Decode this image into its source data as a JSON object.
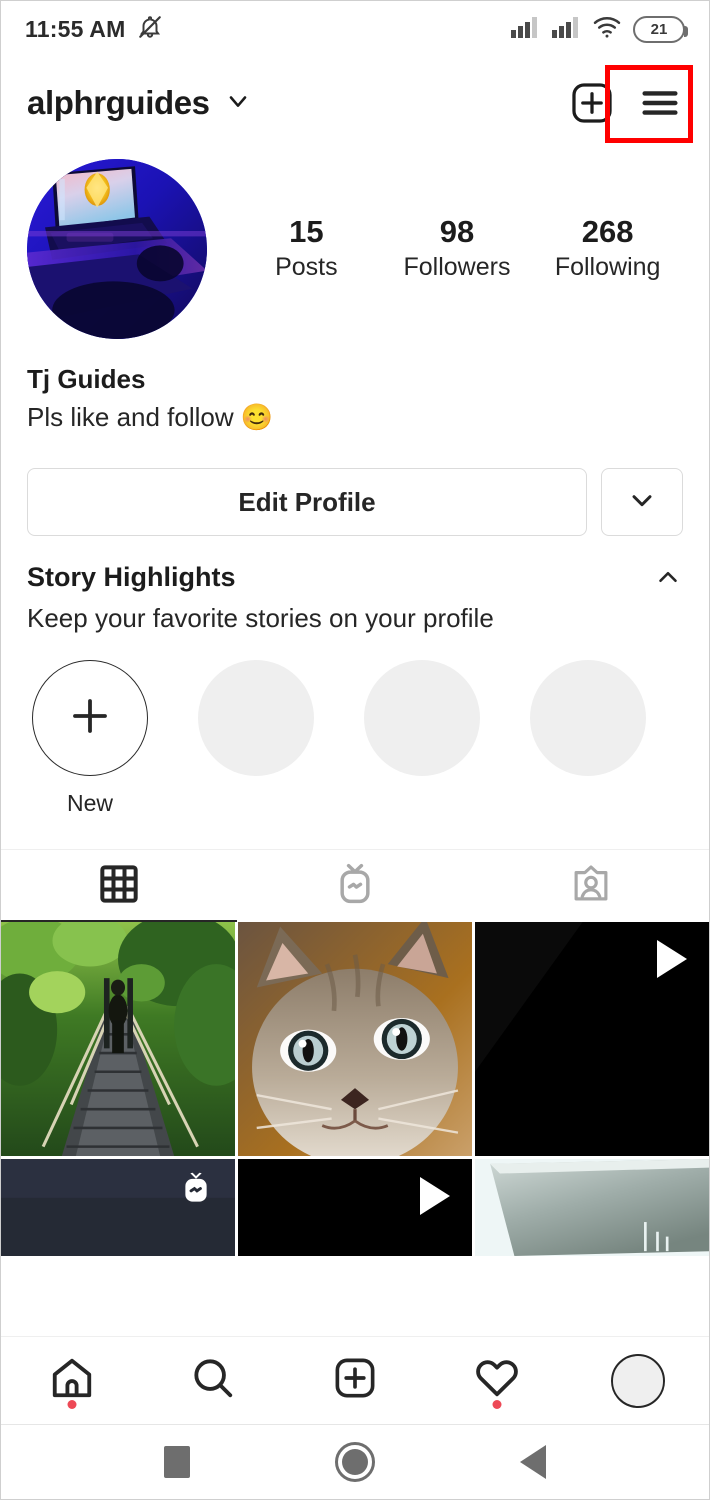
{
  "status_bar": {
    "time": "11:55 AM",
    "notification_icon": "bell-muted-icon",
    "signal_1_icon": "cellular-signal-icon",
    "signal_2_icon": "cellular-signal-icon",
    "wifi_icon": "wifi-icon",
    "battery_level": "21",
    "battery_icon": "battery-icon"
  },
  "header": {
    "username": "alphrguides",
    "dropdown_icon": "chevron-down-icon",
    "add_icon": "plus-square-icon",
    "menu_icon": "hamburger-menu-icon",
    "annotation_color": "#ff0000"
  },
  "profile": {
    "avatar_icon": "profile-avatar",
    "stats": [
      {
        "value": "15",
        "label": "Posts"
      },
      {
        "value": "98",
        "label": "Followers"
      },
      {
        "value": "268",
        "label": "Following"
      }
    ],
    "display_name": "Tj Guides",
    "bio": "Pls like and follow 😊"
  },
  "actions": {
    "edit_profile_label": "Edit Profile",
    "caret_icon": "chevron-down-icon"
  },
  "highlights": {
    "title": "Story Highlights",
    "subtitle": "Keep your favorite stories on your profile",
    "collapse_icon": "chevron-up-icon",
    "new_label": "New",
    "new_icon": "plus-icon",
    "placeholder_count": 3
  },
  "tabs": [
    {
      "name": "grid",
      "icon": "grid-icon",
      "active": true
    },
    {
      "name": "igtv",
      "icon": "igtv-icon",
      "active": false
    },
    {
      "name": "tagged",
      "icon": "tagged-person-icon",
      "active": false
    }
  ],
  "grid_posts": [
    {
      "id": "post-1",
      "type": "photo",
      "subject": "jungle-rope-bridge"
    },
    {
      "id": "post-2",
      "type": "photo",
      "subject": "tabby-kitten"
    },
    {
      "id": "post-3",
      "type": "video",
      "subject": "dark-video",
      "overlay_icon": "play-icon"
    },
    {
      "id": "post-4",
      "type": "igtv",
      "subject": "dark-igtv",
      "overlay_icon": "igtv-icon"
    },
    {
      "id": "post-5",
      "type": "video",
      "subject": "black-video",
      "overlay_icon": "play-icon"
    },
    {
      "id": "post-6",
      "type": "photo",
      "subject": "laptop-lid"
    }
  ],
  "bottom_nav": [
    {
      "name": "home",
      "icon": "home-icon",
      "badge": true
    },
    {
      "name": "search",
      "icon": "search-icon",
      "badge": false
    },
    {
      "name": "create",
      "icon": "plus-square-icon",
      "badge": false
    },
    {
      "name": "activity",
      "icon": "heart-icon",
      "badge": true
    },
    {
      "name": "profile",
      "icon": "profile-avatar-icon",
      "badge": false
    }
  ],
  "system_nav": [
    {
      "name": "recents",
      "icon": "square-icon"
    },
    {
      "name": "home",
      "icon": "circle-icon"
    },
    {
      "name": "back",
      "icon": "triangle-back-icon"
    }
  ]
}
